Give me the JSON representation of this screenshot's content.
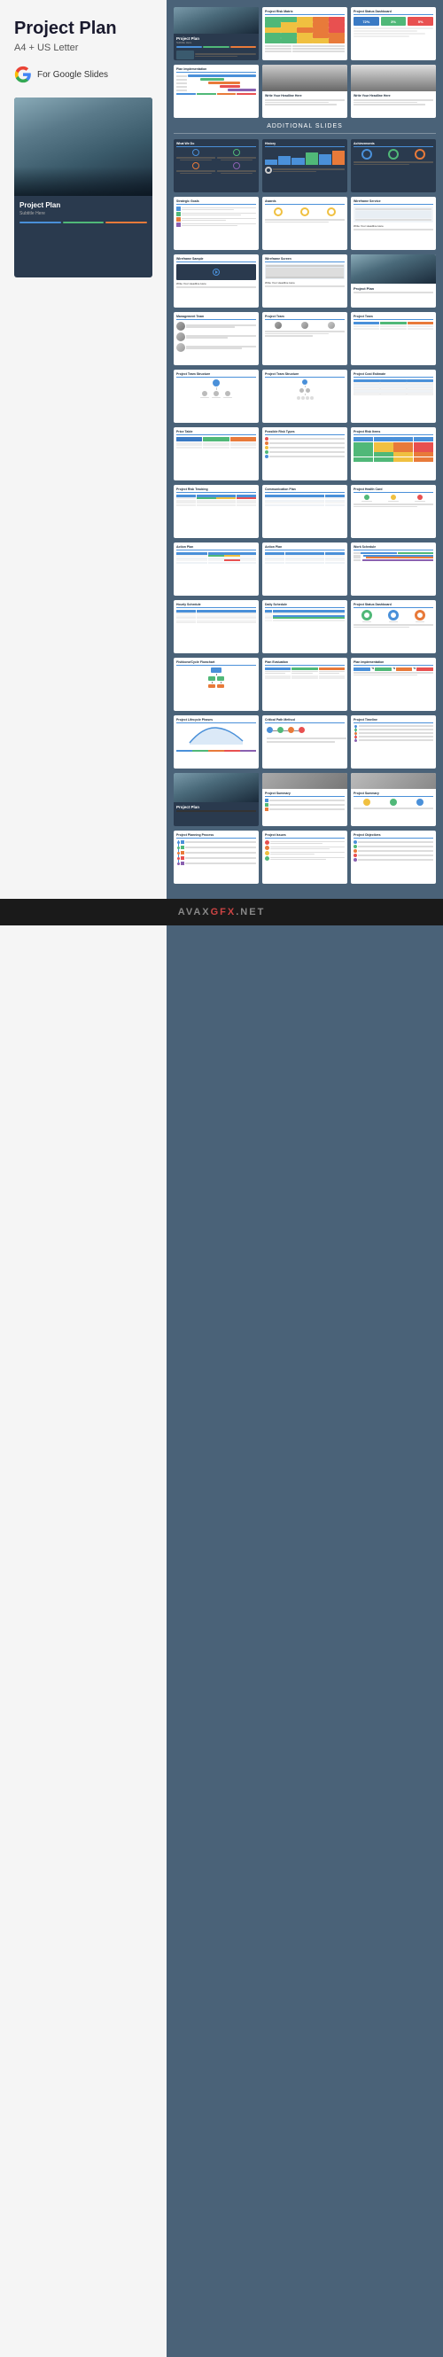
{
  "product": {
    "title": "Project Plan",
    "subtitle": "A4 + US Letter",
    "badge": "For Google Slides",
    "google_icon_color": "#FBBC05"
  },
  "sections": {
    "additional_slides": "Additional Slides"
  },
  "slides": [
    {
      "id": "cover",
      "title": "Project Plan",
      "type": "cover",
      "dark": true
    },
    {
      "id": "risk-matrix",
      "title": "Project Risk Matrix",
      "type": "matrix",
      "dark": false
    },
    {
      "id": "project-status",
      "title": "Project Status Dashboard",
      "type": "dashboard",
      "dark": false
    },
    {
      "id": "plan-impl",
      "title": "Plan Implementation",
      "type": "gantt",
      "dark": false
    },
    {
      "id": "photo1",
      "title": "",
      "type": "photo",
      "dark": false
    },
    {
      "id": "photo2",
      "title": "",
      "type": "photo",
      "dark": false
    },
    {
      "id": "what-we-do",
      "title": "What We Do",
      "type": "icons",
      "dark": true
    },
    {
      "id": "history",
      "title": "History",
      "type": "chart",
      "dark": true
    },
    {
      "id": "achievements",
      "title": "Achievements",
      "type": "circles",
      "dark": true
    },
    {
      "id": "strategic",
      "title": "Strategic Goals",
      "type": "list",
      "dark": false
    },
    {
      "id": "awards",
      "title": "Awards",
      "type": "circles2",
      "dark": false
    },
    {
      "id": "wireframe1",
      "title": "Wireframe Service",
      "type": "wireframe",
      "dark": false
    },
    {
      "id": "wireframe2",
      "title": "Wireframe Sample",
      "type": "video",
      "dark": false
    },
    {
      "id": "wireframe3",
      "title": "Wireframe Screen",
      "type": "screen",
      "dark": false
    },
    {
      "id": "project-plan2",
      "title": "Project Plan",
      "type": "cover2",
      "dark": false
    },
    {
      "id": "mgmt-team",
      "title": "Management Team",
      "type": "team",
      "dark": false
    },
    {
      "id": "project-team2",
      "title": "Project Team",
      "type": "team2",
      "dark": false
    },
    {
      "id": "project-team3",
      "title": "Project Team",
      "type": "team3",
      "dark": false
    },
    {
      "id": "org1",
      "title": "Project Team Structure",
      "type": "org",
      "dark": false
    },
    {
      "id": "org2",
      "title": "Project Team Structure",
      "type": "org2",
      "dark": false
    },
    {
      "id": "cost-est",
      "title": "Project Cost Estimate",
      "type": "table",
      "dark": false
    },
    {
      "id": "price-table",
      "title": "Price Table",
      "type": "pricing",
      "dark": false
    },
    {
      "id": "possible-risks",
      "title": "Possible Risk Types",
      "type": "risk-list",
      "dark": false
    },
    {
      "id": "risk-items",
      "title": "Project Risk Items",
      "type": "risk-matrix2",
      "dark": false
    },
    {
      "id": "risk-tracking",
      "title": "Project Risk Tracking",
      "type": "tracking",
      "dark": false
    },
    {
      "id": "communication",
      "title": "Communication Plan",
      "type": "comm",
      "dark": false
    },
    {
      "id": "health-card",
      "title": "Project Health Card",
      "type": "health",
      "dark": false
    },
    {
      "id": "action-plan1",
      "title": "Action Plan",
      "type": "action",
      "dark": false
    },
    {
      "id": "action-plan2",
      "title": "Action Plan",
      "type": "action2",
      "dark": false
    },
    {
      "id": "work-schedule",
      "title": "Work Schedule",
      "type": "schedule",
      "dark": false
    },
    {
      "id": "hourly-schedule",
      "title": "Hourly Schedule",
      "type": "hourly",
      "dark": false
    },
    {
      "id": "daily-schedule",
      "title": "Daily Schedule",
      "type": "daily",
      "dark": false
    },
    {
      "id": "status-dashboard2",
      "title": "Project Status Dashboard",
      "type": "status2",
      "dark": false
    },
    {
      "id": "fishbone",
      "title": "Fishbone/Cycle Flowchart",
      "type": "fishbone",
      "dark": false
    },
    {
      "id": "plan-eval",
      "title": "Plan Evaluation",
      "type": "eval",
      "dark": false
    },
    {
      "id": "plan-impl2",
      "title": "Plan Implementation",
      "type": "impl",
      "dark": false
    },
    {
      "id": "lifecycle",
      "title": "Project Lifecycle Phases",
      "type": "lifecycle",
      "dark": false
    },
    {
      "id": "critical-path",
      "title": "Critical Path Method",
      "type": "cpm",
      "dark": false
    },
    {
      "id": "timeline",
      "title": "Project Timeline",
      "type": "timeline",
      "dark": false
    },
    {
      "id": "cover3",
      "title": "Project Plan",
      "type": "cover3",
      "dark": true
    },
    {
      "id": "project-summ1",
      "title": "Project Summary",
      "type": "summ1",
      "dark": false
    },
    {
      "id": "project-summ2",
      "title": "Project Summary",
      "type": "summ2",
      "dark": false
    },
    {
      "id": "planning-process",
      "title": "Project Planning Process",
      "type": "process",
      "dark": false
    },
    {
      "id": "issues",
      "title": "Project Issues",
      "type": "issues",
      "dark": false
    },
    {
      "id": "objectives",
      "title": "Project Objectives",
      "type": "objectives",
      "dark": false
    }
  ],
  "colors": {
    "blue": "#3a7ac4",
    "teal": "#4ab0a0",
    "orange": "#e87a3a",
    "red": "#e85050",
    "green": "#50b878",
    "yellow": "#f0c040",
    "purple": "#8a60b0",
    "light_blue": "#5aa0d8",
    "dark_bg": "#2a3a4e",
    "medium_bg": "#3a5068",
    "accent": "#4a90d9"
  },
  "footer": {
    "brand": "AVAX",
    "highlight": "GFX",
    "suffix": ".NET"
  }
}
